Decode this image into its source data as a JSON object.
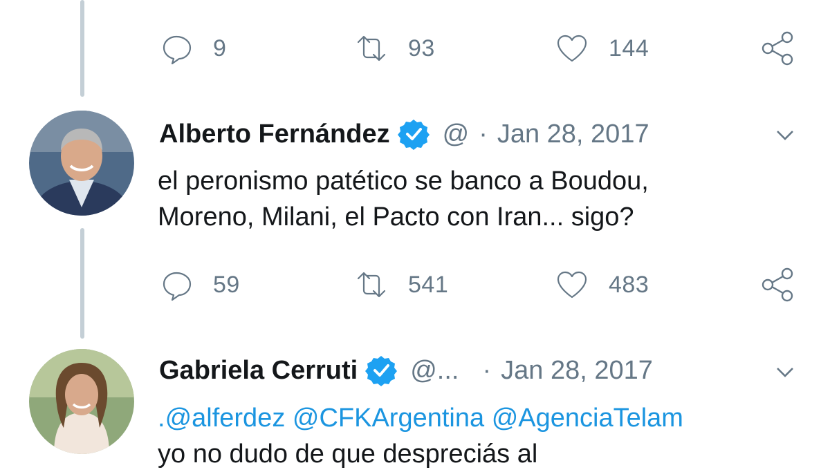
{
  "top_tweet": {
    "stats": {
      "replies": "9",
      "retweets": "93",
      "likes": "144"
    }
  },
  "tweet1": {
    "name": "Alberto Fernández",
    "handle": "@",
    "separator": "·",
    "date": "Jan 28, 2017",
    "text_line1": "el peronismo patético se banco a Boudou,",
    "text_line2": "Moreno, Milani, el Pacto con Iran... sigo?",
    "stats": {
      "replies": "59",
      "retweets": "541",
      "likes": "483"
    }
  },
  "tweet2": {
    "name": "Gabriela Cerruti",
    "handle": "@...",
    "separator": "·",
    "date": "Jan 28, 2017",
    "mentions_prefix": ".",
    "mention1": "@alferdez",
    "mention2": "@CFKArgentina",
    "mention3": "@AgenciaTelam",
    "text_line2": "yo no dudo de que despreciás al"
  },
  "colors": {
    "link": "#1b95e0",
    "verified": "#1da1f2",
    "muted": "#657786",
    "thread_line": "#c4cfd6"
  },
  "icons": [
    "reply-icon",
    "retweet-icon",
    "like-icon",
    "share-icon",
    "verified-badge-icon",
    "chevron-down-icon"
  ]
}
